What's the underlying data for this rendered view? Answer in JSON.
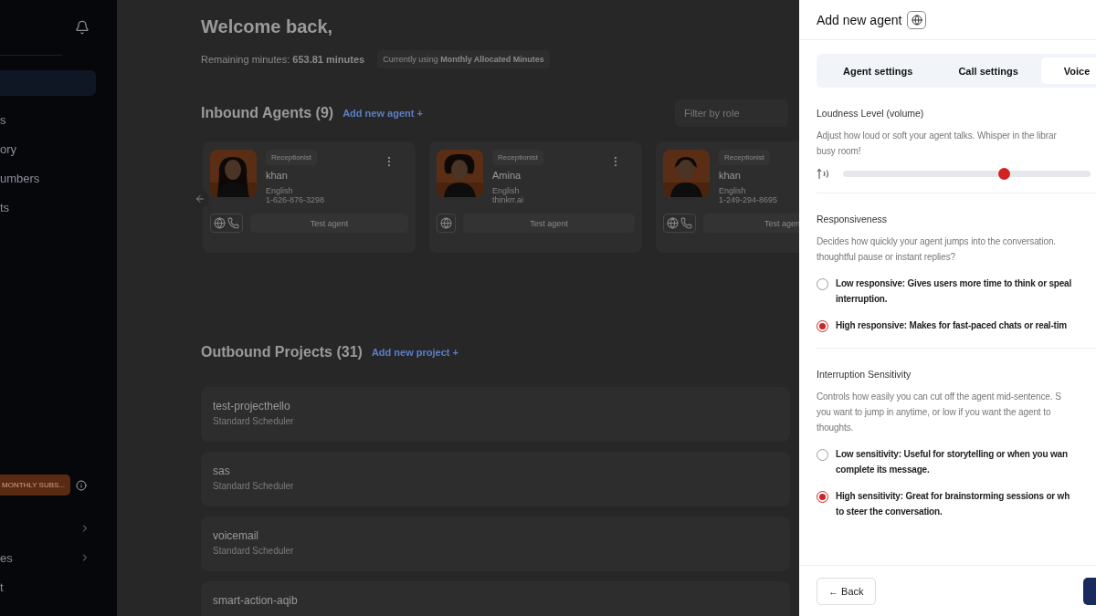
{
  "sidebar": {
    "nav": [
      {
        "selected": true
      },
      {
        "label": "s",
        "selected": false
      },
      {
        "label": "ory",
        "selected": false
      },
      {
        "label": "umbers",
        "selected": false
      },
      {
        "label": "ts",
        "selected": false
      }
    ],
    "subscription": "MONTHLY SUBS...",
    "bottom": [
      {
        "kind": "expandable"
      },
      {
        "kind": "expandable",
        "label": "es"
      },
      {
        "kind": "link",
        "label": "t"
      }
    ]
  },
  "header": {
    "title": "Welcome back,",
    "remaining": "Remaining minutes: **653.81 minutes**",
    "usage_badge": "Currently using **Monthly Allocated Minutes**"
  },
  "inbound": {
    "title": "Inbound Agents (9)",
    "add_link": "Add new agent +",
    "filter": {
      "placeholder": "Filter by role"
    },
    "agents": [
      {
        "role": "Receptionist",
        "name": "khan",
        "language": "English",
        "detail": "1-626-876-3298",
        "phone_channel": true,
        "test": "Test agent"
      },
      {
        "role": "Receptionist",
        "name": "Amina",
        "language": "English",
        "detail": "thinkrr.ai",
        "phone_channel": false,
        "test": "Test agent"
      },
      {
        "role": "Receptionist",
        "name": "khan",
        "language": "English",
        "detail": "1-249-294-8695",
        "phone_channel": true,
        "test": "Test agen"
      }
    ]
  },
  "outbound": {
    "title": "Outbound Projects (31)",
    "add_link": "Add new project +",
    "projects": [
      {
        "name": "test-projecthello",
        "scheduler": "Standard Scheduler"
      },
      {
        "name": "sas",
        "scheduler": "Standard Scheduler"
      },
      {
        "name": "voicemail",
        "scheduler": "Standard Scheduler"
      },
      {
        "name": "smart-action-aqib"
      }
    ]
  },
  "drawer": {
    "title": "Add new agent",
    "tabs": [
      {
        "label": "Agent settings",
        "selected": false
      },
      {
        "label": "Call settings",
        "selected": false
      },
      {
        "label": "Voice",
        "selected": true
      }
    ],
    "sections": [
      {
        "kind": "slider",
        "title": "Loudness Level (volume)",
        "description": [
          "Adjust how loud or soft your agent talks. Whisper in the librar",
          "busy room!"
        ],
        "level": 0.65
      },
      {
        "kind": "radio",
        "title": "Responsiveness",
        "description": [
          "Decides how quickly your agent jumps into the conversation.",
          "thoughtful pause or instant replies?"
        ],
        "options": [
          {
            "lines": [
              "Low responsive: Gives users more time to think or speal",
              "interruption."
            ],
            "selected": false
          },
          {
            "lines": [
              "High responsive: Makes for fast-paced chats or real-tim"
            ],
            "selected": true
          }
        ]
      },
      {
        "kind": "radio",
        "title": "Interruption Sensitivity",
        "description": [
          "Controls how easily you can cut off the agent mid-sentence. S",
          "you want to jump in anytime, or low if you want the agent to",
          "thoughts."
        ],
        "options": [
          {
            "lines": [
              "Low sensitivity: Useful for storytelling or when you wan",
              "complete its message."
            ],
            "selected": false
          },
          {
            "lines": [
              "High sensitivity: Great for brainstorming sessions or wh",
              "to steer the conversation."
            ],
            "selected": true
          }
        ]
      }
    ],
    "back": "← Back"
  }
}
